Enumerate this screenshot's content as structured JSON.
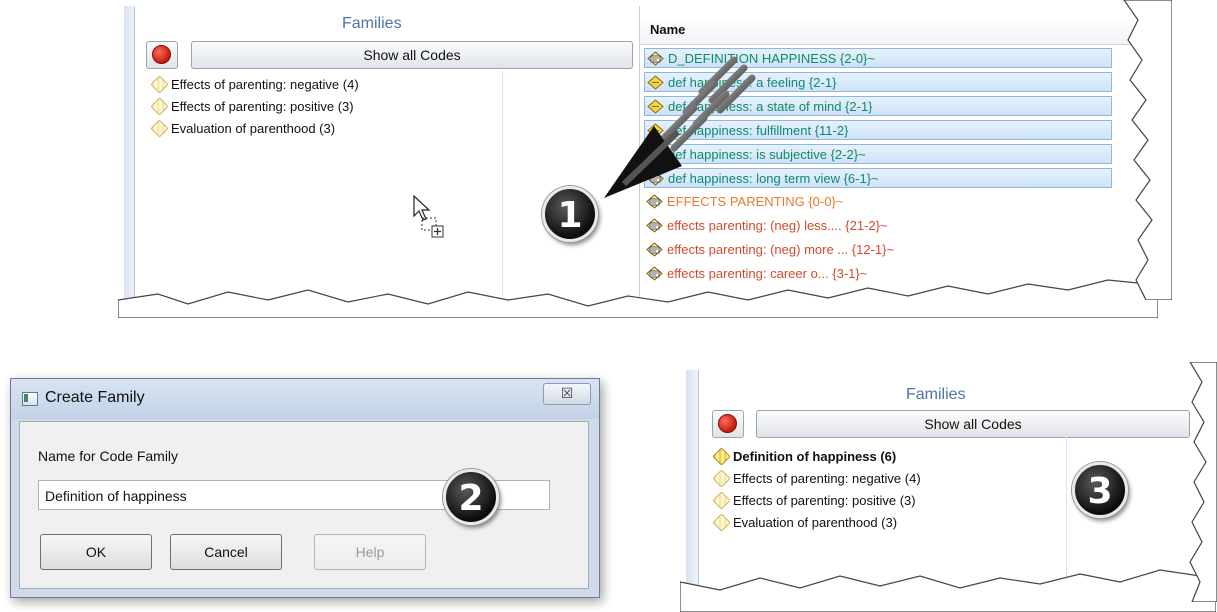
{
  "panel1": {
    "families_title": "Families",
    "show_all_codes": "Show all Codes",
    "families": [
      {
        "label": "Effects of parenting: negative (4)"
      },
      {
        "label": "Effects of parenting: positive (3)"
      },
      {
        "label": "Evaluation of parenthood (3)"
      }
    ],
    "code_header": "Name",
    "codes": [
      {
        "label": "D_DEFINITION HAPPINESS {2-0}~",
        "color": "green",
        "selected": true
      },
      {
        "label": "def happiness: a feeling {2-1}",
        "color": "green",
        "selected": true
      },
      {
        "label": "def happiness: a state of mind {2-1}",
        "color": "green",
        "selected": true
      },
      {
        "label": "def happiness: fulfillment {11-2}",
        "color": "green",
        "selected": true
      },
      {
        "label": "def happiness: is subjective {2-2}~",
        "color": "green",
        "selected": true
      },
      {
        "label": "def happiness: long term view {6-1}~",
        "color": "green",
        "selected": true
      },
      {
        "label": "EFFECTS PARENTING {0-0}~",
        "color": "orange",
        "selected": false
      },
      {
        "label": "effects parenting: (neg) less.... {21-2}~",
        "color": "red",
        "selected": false
      },
      {
        "label": "effects parenting: (neg) more ... {12-1}~",
        "color": "red",
        "selected": false
      },
      {
        "label": "effects parenting: career o... {3-1}~",
        "color": "red",
        "selected": false
      }
    ],
    "badge": "1"
  },
  "dialog": {
    "title": "Create Family",
    "close_glyph": "☒",
    "field_label": "Name for Code Family",
    "field_value": "Definition of happiness",
    "ok": "OK",
    "cancel": "Cancel",
    "help": "Help",
    "badge": "2"
  },
  "panel3": {
    "families_title": "Families",
    "show_all_codes": "Show all Codes",
    "families": [
      {
        "label": "Definition of happiness (6)",
        "bold": true
      },
      {
        "label": "Effects of parenting: negative (4)",
        "bold": false
      },
      {
        "label": "Effects of parenting: positive (3)",
        "bold": false
      },
      {
        "label": "Evaluation of parenthood (3)",
        "bold": false
      }
    ],
    "badge": "3"
  },
  "colors": {
    "green_code": "#0f8a6a",
    "orange_code": "#e87a2a",
    "red_code": "#d44a2e",
    "selection": "#cfe3f7",
    "families_title": "#4f73a8"
  }
}
